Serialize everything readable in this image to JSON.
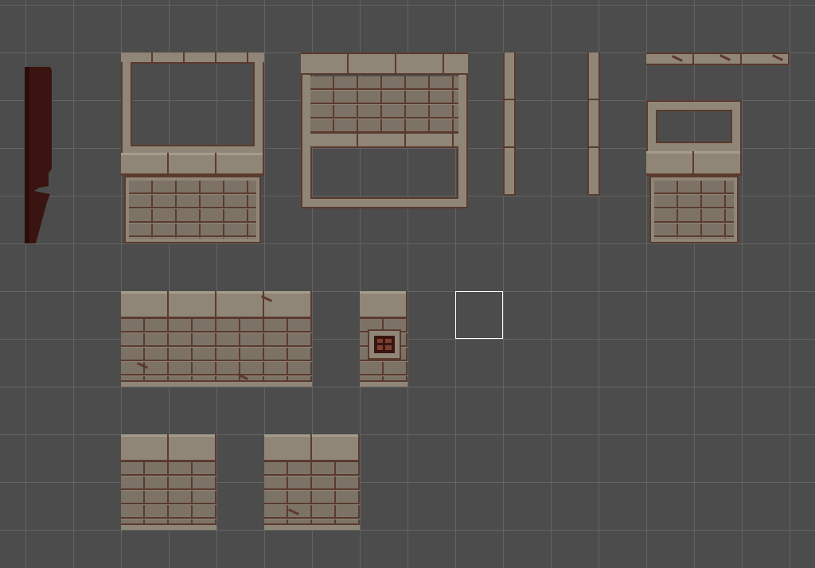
{
  "scene": {
    "background_color": "#4c4c4c",
    "grid_color": "#646464",
    "grid_cell": 60
  },
  "palette": {
    "stone": "#8f8677",
    "brick": "#7c7366",
    "mortar": "#5b3a2e",
    "highlight": "#a59c8c",
    "shadow_strip": "#3a1410",
    "selection": "#ffffff"
  },
  "tiles": [
    {
      "name": "dark-shadow-strip"
    },
    {
      "name": "arch-frame-with-brick-base"
    },
    {
      "name": "double-window-frame"
    },
    {
      "name": "stone-pillar-left"
    },
    {
      "name": "stone-pillar-right"
    },
    {
      "name": "stone-rail"
    },
    {
      "name": "small-window-brick-base"
    },
    {
      "name": "brick-wall-wide"
    },
    {
      "name": "brick-wall-with-switch"
    },
    {
      "name": "empty-selected-cell"
    },
    {
      "name": "brick-wall-small-a"
    },
    {
      "name": "brick-wall-small-b"
    }
  ]
}
